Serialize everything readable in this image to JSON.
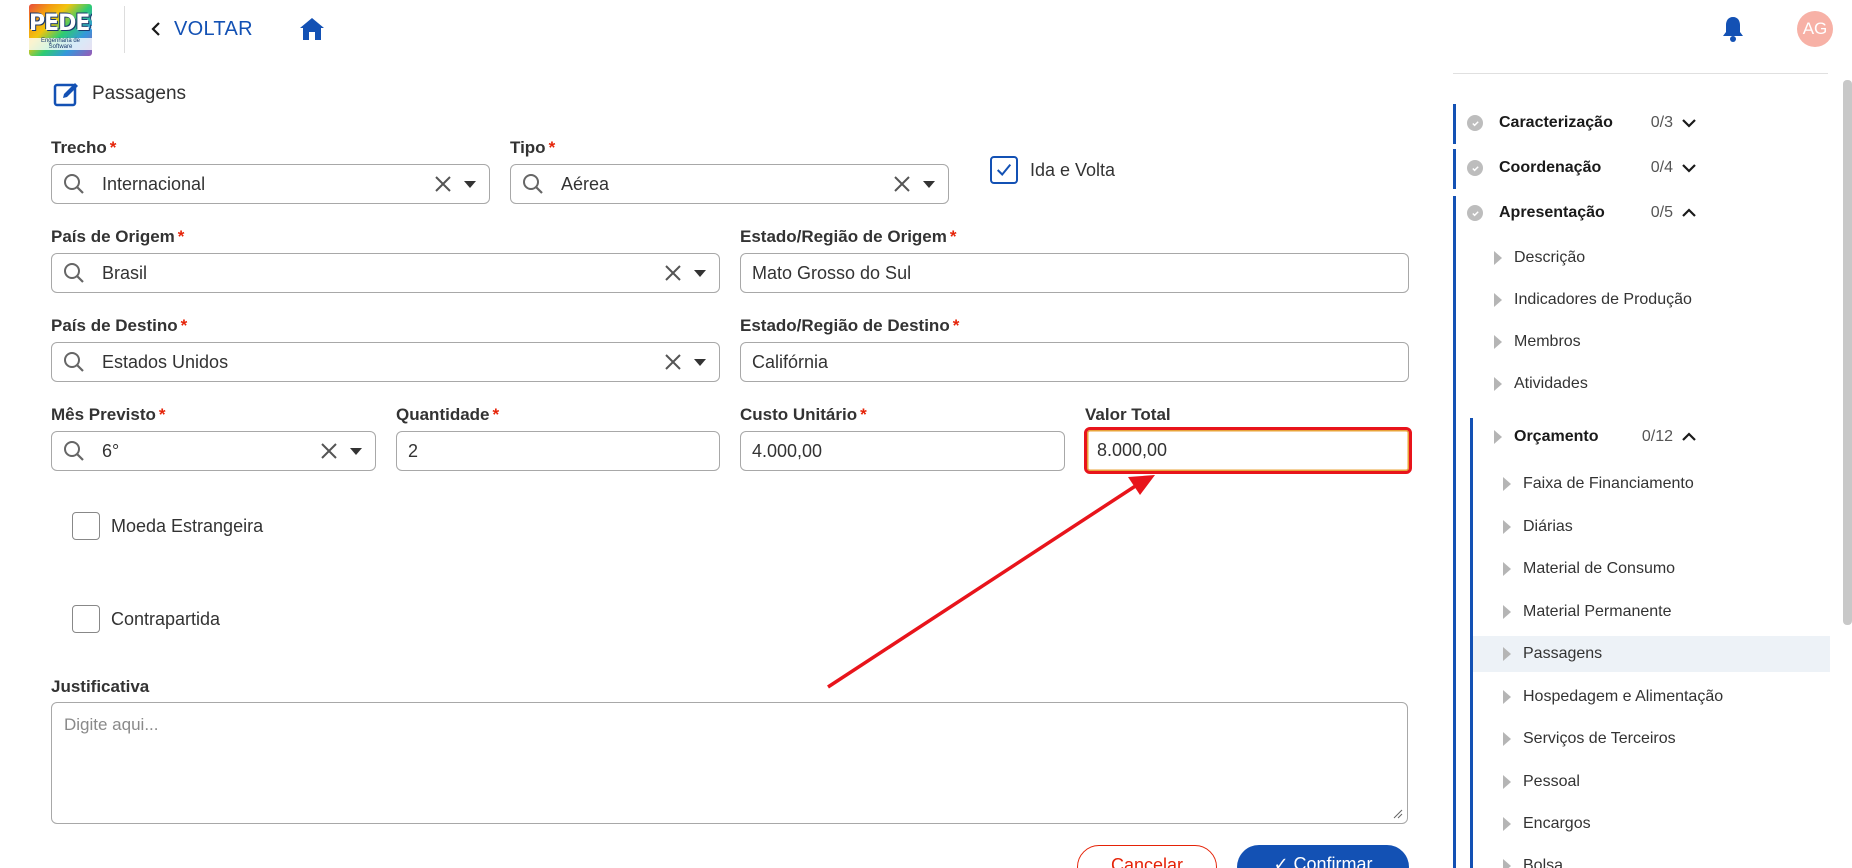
{
  "header": {
    "logo_text": "PEDES",
    "logo_sub": "Engenharia de Software",
    "back_label": "VOLTAR",
    "avatar_initials": "AG"
  },
  "section": {
    "title": "Passagens"
  },
  "form": {
    "trecho": {
      "label": "Trecho",
      "value": "Internacional"
    },
    "tipo": {
      "label": "Tipo",
      "value": "Aérea"
    },
    "ida_volta": {
      "label": "Ida e Volta",
      "checked": true
    },
    "pais_origem": {
      "label": "País de Origem",
      "value": "Brasil"
    },
    "estado_origem": {
      "label": "Estado/Região de Origem",
      "value": "Mato Grosso do Sul"
    },
    "pais_destino": {
      "label": "País de Destino",
      "value": "Estados Unidos"
    },
    "estado_destino": {
      "label": "Estado/Região de Destino",
      "value": "Califórnia"
    },
    "mes_previsto": {
      "label": "Mês Previsto",
      "value": "6°"
    },
    "quantidade": {
      "label": "Quantidade",
      "value": "2"
    },
    "custo_unitario": {
      "label": "Custo Unitário",
      "value": "4.000,00"
    },
    "valor_total": {
      "label": "Valor Total",
      "value": "8.000,00"
    },
    "moeda_estrangeira": {
      "label": "Moeda Estrangeira",
      "checked": false
    },
    "contrapartida": {
      "label": "Contrapartida",
      "checked": false
    },
    "justificativa": {
      "label": "Justificativa",
      "placeholder": "Digite aqui..."
    },
    "required_mark": "*",
    "cancel_label": "Cancelar",
    "confirm_label": "✓ Confirmar"
  },
  "sidebar": {
    "sections": [
      {
        "label": "Caracterização",
        "count": "0/3",
        "expanded": false
      },
      {
        "label": "Coordenação",
        "count": "0/4",
        "expanded": false
      },
      {
        "label": "Apresentação",
        "count": "0/5",
        "expanded": true
      }
    ],
    "apresentacao_items": [
      "Descrição",
      "Indicadores de Produção",
      "Membros",
      "Atividades"
    ],
    "orcamento": {
      "label": "Orçamento",
      "count": "0/12",
      "expanded": true
    },
    "orcamento_items": [
      "Faixa de Financiamento",
      "Diárias",
      "Material de Consumo",
      "Material Permanente",
      "Passagens",
      "Hospedagem e Alimentação",
      "Serviços de Terceiros",
      "Pessoal",
      "Encargos",
      "Bolsa"
    ],
    "active_item": "Passagens"
  },
  "colors": {
    "primary": "#1351b4",
    "danger": "#e52207",
    "highlight_box": "#e8141b",
    "annotation_arrow": "#e8141b"
  }
}
